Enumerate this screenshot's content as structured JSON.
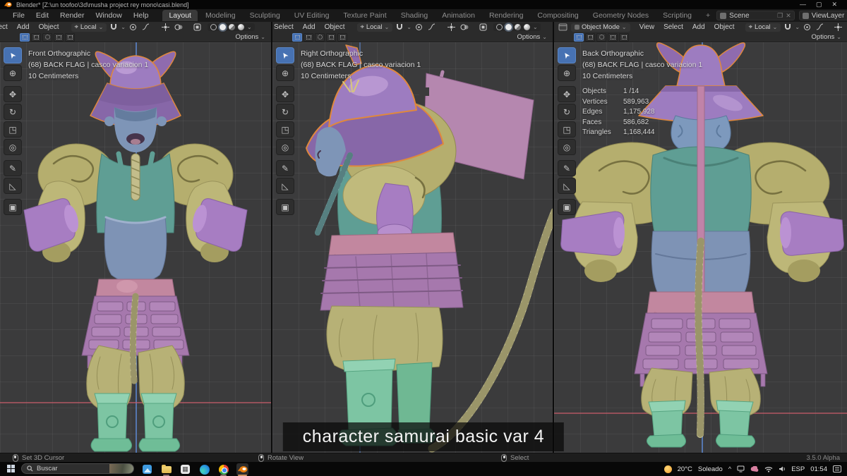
{
  "titlebar": {
    "title": "Blender* [Z:\\un toofoo\\3d\\musha project rey mono\\casi.blend]"
  },
  "icons": {
    "minimize": "—",
    "maximize": "▢",
    "close": "✕",
    "caret": "⌄",
    "chevron_up": "^"
  },
  "topbar": {
    "menus": [
      "File",
      "Edit",
      "Render",
      "Window",
      "Help"
    ],
    "tabs": [
      "Layout",
      "Modeling",
      "Sculpting",
      "UV Editing",
      "Texture Paint",
      "Shading",
      "Animation",
      "Rendering",
      "Compositing",
      "Geometry Nodes",
      "Scripting",
      "+"
    ],
    "active_tab": "Layout",
    "scene": "Scene",
    "view_layer": "ViewLayer"
  },
  "viewport_header": {
    "mode": "Object Mode",
    "menus": [
      "Select",
      "Add",
      "Object"
    ],
    "menus_vp3": [
      "View",
      "Select",
      "Add",
      "Object"
    ],
    "orientation": "Local",
    "options": "Options"
  },
  "viewports": [
    {
      "view": "Front Orthographic",
      "item": "(68) BACK FLAG | casco variacion 1",
      "scale": "10 Centimeters"
    },
    {
      "view": "Right Orthographic",
      "item": "(68) BACK FLAG | casco variacion 1",
      "scale": "10 Centimeters"
    },
    {
      "view": "Back Orthographic",
      "item": "(68) BACK FLAG | casco variacion 1",
      "scale": "10 Centimeters"
    }
  ],
  "stats": {
    "labels": [
      "Objects",
      "Vertices",
      "Edges",
      "Faces",
      "Triangles"
    ],
    "values": [
      "1 /14",
      "589,963",
      "1,175,928",
      "586,682",
      "1,168,444"
    ]
  },
  "tool_glyphs": {
    "select": "➤",
    "cursor": "⊕",
    "move": "✥",
    "rotate": "↻",
    "scale": "◳",
    "transform": "◎",
    "annotate": "✎",
    "measure": "◺",
    "cube": "▣"
  },
  "statusbar": {
    "hints": [
      "Set 3D Cursor",
      "Rotate View",
      "Select"
    ],
    "version": "3.5.0 Alpha"
  },
  "subtitle": "character samurai basic var 4",
  "taskbar": {
    "search": "Buscar",
    "tray": {
      "temp": "20°C",
      "weather": "Soleado",
      "lang": "ESP",
      "time": "01:54"
    }
  },
  "colors": {
    "selection_outline": "#e0883c",
    "helmet_purple": "#9d7cc0",
    "armor_khaki": "#b5ae6e",
    "chest_teal": "#5f9e94",
    "plate_blue": "#7e93b5",
    "belt_pink": "#c2879f",
    "skirt_purple": "#a678ad",
    "boots_mint": "#7dc5a3",
    "rope_tan": "#c8c393",
    "viewport_bg": "#3b3b3c",
    "accent_blue": "#4772b3"
  }
}
